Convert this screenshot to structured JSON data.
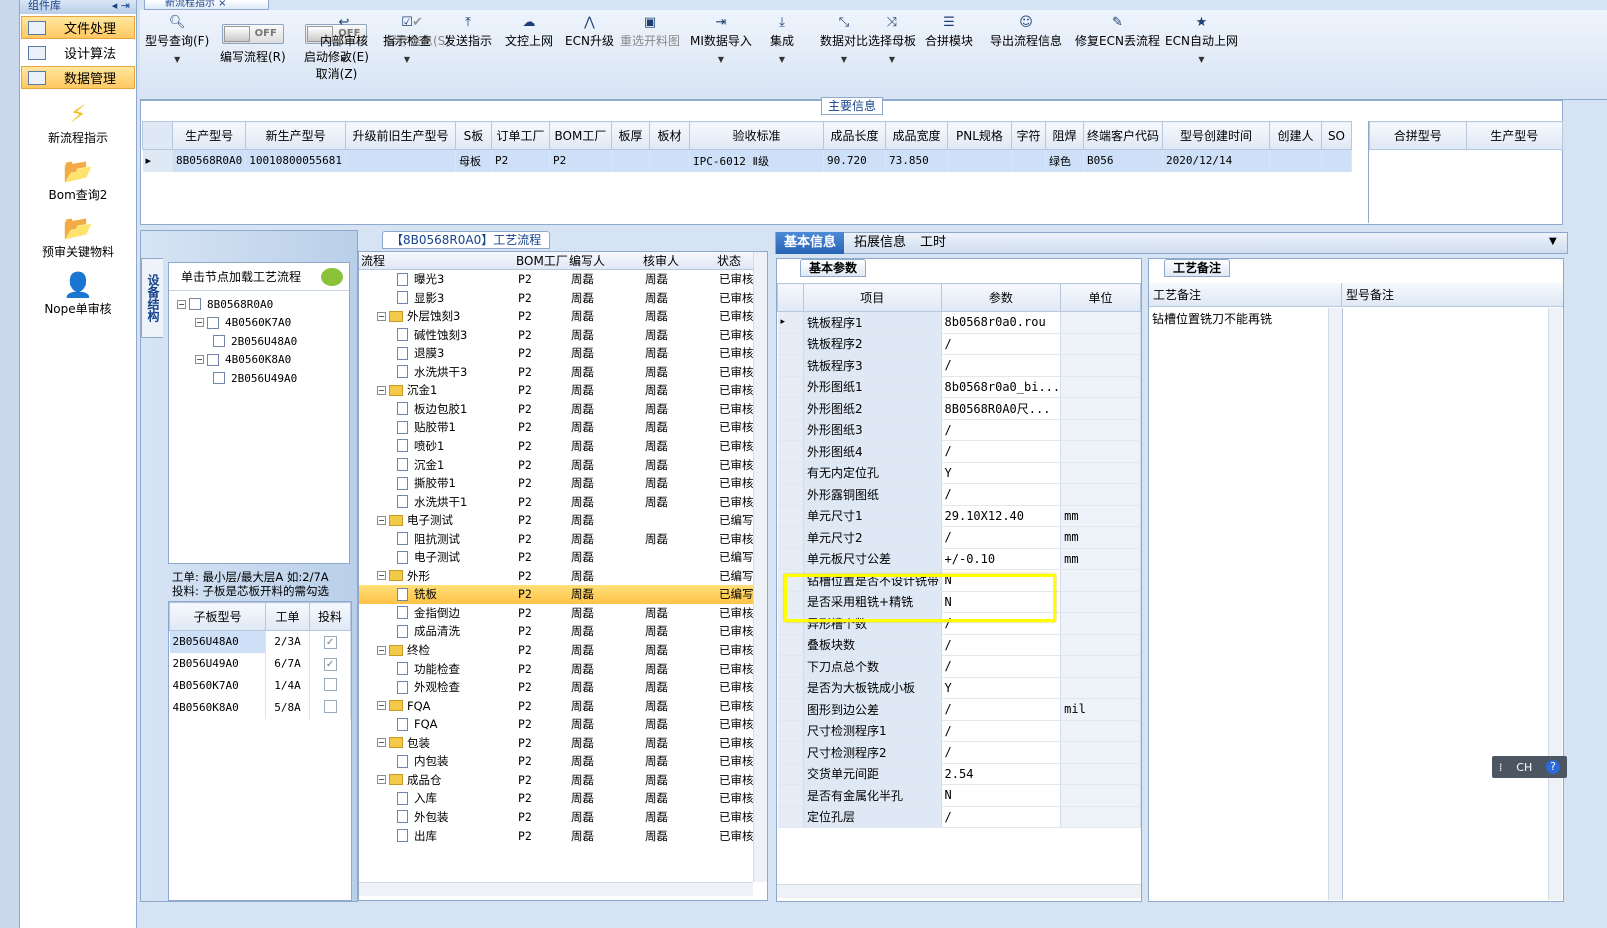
{
  "nav": {
    "title": "组件库",
    "items": [
      {
        "label": "文件处理",
        "selected": true
      },
      {
        "label": "设计算法",
        "selected": false
      },
      {
        "label": "数据管理",
        "selected": true
      }
    ],
    "big_icons": [
      {
        "label": "新流程指示",
        "icon": "lightning-icon"
      },
      {
        "label": "Bom查询2",
        "icon": "folder-icon"
      },
      {
        "label": "预审关键物料",
        "icon": "folder-icon"
      },
      {
        "label": "Nope单审核",
        "icon": "user-icon"
      }
    ]
  },
  "doc_tab": "新流程指示",
  "toolbar": {
    "query": "型号查询(F)",
    "write_flow": "编写流程(R)",
    "start_modify": "启动修改(E)",
    "cancel": "取消(Z)",
    "toggle_off": "OFF",
    "save": "保存信息(S)",
    "buttons": [
      {
        "label": "内部审核",
        "icon": "↩",
        "dropdown": true
      },
      {
        "label": "指示检查",
        "icon": "☑",
        "dropdown": true
      },
      {
        "label": "发送指示",
        "icon": "⤒",
        "dropdown": false
      },
      {
        "label": "文控上网",
        "icon": "☁",
        "dropdown": false
      },
      {
        "label": "ECN升级",
        "icon": "⋀",
        "dropdown": false
      },
      {
        "label": "重选开料图",
        "icon": "▣",
        "dropdown": false,
        "disabled": true
      },
      {
        "label": "MI数据导入",
        "icon": "⇥",
        "dropdown": true
      },
      {
        "label": "集成",
        "icon": "⤓",
        "dropdown": true
      },
      {
        "label": "数据对比",
        "icon": "⤡",
        "dropdown": true
      },
      {
        "label": "选择母板",
        "icon": "⤨",
        "dropdown": true
      },
      {
        "label": "合拼模块",
        "icon": "☰",
        "dropdown": false
      },
      {
        "label": "导出流程信息",
        "icon": "☺",
        "dropdown": false
      },
      {
        "label": "修复ECN丢流程",
        "icon": "✎",
        "dropdown": false
      },
      {
        "label": "ECN自动上网",
        "icon": "★",
        "dropdown": true
      }
    ]
  },
  "main_info": {
    "legend": "主要信息",
    "columns": [
      "生产型号",
      "新生产型号",
      "升级前旧生产型号",
      "S板",
      "订单工厂",
      "BOM工厂",
      "板厚",
      "板材",
      "验收标准",
      "成品长度",
      "成品宽度",
      "PNL规格",
      "字符",
      "阻焊",
      "终端客户代码",
      "型号创建时间",
      "创建人",
      "SO"
    ],
    "row": [
      "8B0568R0A0",
      "10010800055681",
      "",
      "母板",
      "P2",
      "P2",
      "",
      "",
      "IPC-6012 Ⅱ级",
      "90.720",
      "73.850",
      "",
      "",
      "绿色",
      "B056",
      "2020/12/14",
      "",
      ""
    ],
    "merge_columns": [
      "合拼型号",
      "生产型号"
    ]
  },
  "tree_panel": {
    "side_tab": "设备结构",
    "header": "单击节点加载工艺流程",
    "nodes": [
      {
        "label": "8B0568R0A0",
        "level": 0
      },
      {
        "label": "4B0560K7A0",
        "level": 1
      },
      {
        "label": "2B056U48A0",
        "level": 2
      },
      {
        "label": "4B0560K8A0",
        "level": 1
      },
      {
        "label": "2B056U49A0",
        "level": 2
      }
    ],
    "note1": "工单: 最小层/最大层A 如:2/7A",
    "note2": "投料: 子板是芯板开料的需勾选",
    "sub_columns": [
      "子板型号",
      "工单",
      "投料"
    ],
    "sub_rows": [
      {
        "model": "2B056U48A0",
        "order": "2/3A",
        "checked": true
      },
      {
        "model": "2B056U49A0",
        "order": "6/7A",
        "checked": true
      },
      {
        "model": "4B0560K7A0",
        "order": "1/4A",
        "checked": false
      },
      {
        "model": "4B0560K8A0",
        "order": "5/8A",
        "checked": false
      }
    ]
  },
  "flow_panel": {
    "title": "【8B0568R0A0】工艺流程",
    "columns": [
      "流程",
      "BOM工厂",
      "编写人",
      "核审人",
      "状态"
    ],
    "rows": [
      {
        "name": "曝光3",
        "type": "doc",
        "bom": "P2",
        "writer": "周磊",
        "checker": "周磊",
        "status": "已审核"
      },
      {
        "name": "显影3",
        "type": "doc",
        "bom": "P2",
        "writer": "周磊",
        "checker": "周磊",
        "status": "已审核"
      },
      {
        "name": "外层蚀刻3",
        "type": "folder",
        "bom": "P2",
        "writer": "周磊",
        "checker": "周磊",
        "status": "已审核"
      },
      {
        "name": "碱性蚀刻3",
        "type": "doc",
        "bom": "P2",
        "writer": "周磊",
        "checker": "周磊",
        "status": "已审核"
      },
      {
        "name": "退膜3",
        "type": "doc",
        "bom": "P2",
        "writer": "周磊",
        "checker": "周磊",
        "status": "已审核"
      },
      {
        "name": "水洗烘干3",
        "type": "doc",
        "bom": "P2",
        "writer": "周磊",
        "checker": "周磊",
        "status": "已审核"
      },
      {
        "name": "沉金1",
        "type": "folder",
        "bom": "P2",
        "writer": "周磊",
        "checker": "周磊",
        "status": "已审核"
      },
      {
        "name": "板边包胶1",
        "type": "doc",
        "bom": "P2",
        "writer": "周磊",
        "checker": "周磊",
        "status": "已审核"
      },
      {
        "name": "贴胶带1",
        "type": "doc",
        "bom": "P2",
        "writer": "周磊",
        "checker": "周磊",
        "status": "已审核"
      },
      {
        "name": "喷砂1",
        "type": "doc",
        "bom": "P2",
        "writer": "周磊",
        "checker": "周磊",
        "status": "已审核"
      },
      {
        "name": "沉金1",
        "type": "doc",
        "bom": "P2",
        "writer": "周磊",
        "checker": "周磊",
        "status": "已审核"
      },
      {
        "name": "撕胶带1",
        "type": "doc",
        "bom": "P2",
        "writer": "周磊",
        "checker": "周磊",
        "status": "已审核"
      },
      {
        "name": "水洗烘干1",
        "type": "doc",
        "bom": "P2",
        "writer": "周磊",
        "checker": "周磊",
        "status": "已审核"
      },
      {
        "name": "电子测试",
        "type": "folder",
        "bom": "P2",
        "writer": "周磊",
        "checker": "",
        "status": "已编写"
      },
      {
        "name": "阻抗测试",
        "type": "doc",
        "bom": "P2",
        "writer": "周磊",
        "checker": "周磊",
        "status": "已审核"
      },
      {
        "name": "电子测试",
        "type": "doc",
        "bom": "P2",
        "writer": "周磊",
        "checker": "",
        "status": "已编写"
      },
      {
        "name": "外形",
        "type": "folder",
        "bom": "P2",
        "writer": "周磊",
        "checker": "",
        "status": "已编写"
      },
      {
        "name": "铣板",
        "type": "doc",
        "bom": "P2",
        "writer": "周磊",
        "checker": "",
        "status": "已编写",
        "selected": true
      },
      {
        "name": "金指倒边",
        "type": "doc",
        "bom": "P2",
        "writer": "周磊",
        "checker": "周磊",
        "status": "已审核"
      },
      {
        "name": "成品清洗",
        "type": "doc",
        "bom": "P2",
        "writer": "周磊",
        "checker": "周磊",
        "status": "已审核"
      },
      {
        "name": "终检",
        "type": "folder",
        "bom": "P2",
        "writer": "周磊",
        "checker": "周磊",
        "status": "已审核"
      },
      {
        "name": "功能检查",
        "type": "doc",
        "bom": "P2",
        "writer": "周磊",
        "checker": "周磊",
        "status": "已审核"
      },
      {
        "name": "外观检查",
        "type": "doc",
        "bom": "P2",
        "writer": "周磊",
        "checker": "周磊",
        "status": "已审核"
      },
      {
        "name": "FQA",
        "type": "folder",
        "bom": "P2",
        "writer": "周磊",
        "checker": "周磊",
        "status": "已审核"
      },
      {
        "name": "FQA",
        "type": "doc",
        "bom": "P2",
        "writer": "周磊",
        "checker": "周磊",
        "status": "已审核"
      },
      {
        "name": "包装",
        "type": "folder",
        "bom": "P2",
        "writer": "周磊",
        "checker": "周磊",
        "status": "已审核"
      },
      {
        "name": "内包装",
        "type": "doc",
        "bom": "P2",
        "writer": "周磊",
        "checker": "周磊",
        "status": "已审核"
      },
      {
        "name": "成品仓",
        "type": "folder",
        "bom": "P2",
        "writer": "周磊",
        "checker": "周磊",
        "status": "已审核"
      },
      {
        "name": "入库",
        "type": "doc",
        "bom": "P2",
        "writer": "周磊",
        "checker": "周磊",
        "status": "已审核"
      },
      {
        "name": "外包装",
        "type": "doc",
        "bom": "P2",
        "writer": "周磊",
        "checker": "周磊",
        "status": "已审核"
      },
      {
        "name": "出库",
        "type": "doc",
        "bom": "P2",
        "writer": "周磊",
        "checker": "周磊",
        "status": "已审核"
      }
    ]
  },
  "info_tabs": [
    "基本信息",
    "拓展信息",
    "工时"
  ],
  "params": {
    "tab": "基本参数",
    "columns": [
      "项目",
      "参数",
      "单位"
    ],
    "rows": [
      {
        "item": "铣板程序1",
        "value": "8b0568r0a0.rou",
        "unit": ""
      },
      {
        "item": "铣板程序2",
        "value": "/",
        "unit": ""
      },
      {
        "item": "铣板程序3",
        "value": "/",
        "unit": ""
      },
      {
        "item": "外形图纸1",
        "value": "8b0568r0a0_bi...",
        "unit": ""
      },
      {
        "item": "外形图纸2",
        "value": "8B0568R0A0尺...",
        "unit": ""
      },
      {
        "item": "外形图纸3",
        "value": "/",
        "unit": ""
      },
      {
        "item": "外形图纸4",
        "value": "/",
        "unit": ""
      },
      {
        "item": "有无内定位孔",
        "value": "Y",
        "unit": ""
      },
      {
        "item": "外形露铜图纸",
        "value": "/",
        "unit": ""
      },
      {
        "item": "单元尺寸1",
        "value": "29.10X12.40",
        "unit": "mm"
      },
      {
        "item": "单元尺寸2",
        "value": "/",
        "unit": "mm"
      },
      {
        "item": "单元板尺寸公差",
        "value": "+/-0.10",
        "unit": "mm"
      },
      {
        "item": "钻槽位置是否不设计铣带",
        "value": "N",
        "unit": ""
      },
      {
        "item": "是否采用粗铣+精铣",
        "value": "N",
        "unit": ""
      },
      {
        "item": "异形槽个数",
        "value": "/",
        "unit": ""
      },
      {
        "item": "叠板块数",
        "value": "/",
        "unit": ""
      },
      {
        "item": "下刀点总个数",
        "value": "/",
        "unit": ""
      },
      {
        "item": "是否为大板铣成小板",
        "value": "Y",
        "unit": ""
      },
      {
        "item": "图形到边公差",
        "value": "/",
        "unit": "mil"
      },
      {
        "item": "尺寸检测程序1",
        "value": "/",
        "unit": ""
      },
      {
        "item": "尺寸检测程序2",
        "value": "/",
        "unit": ""
      },
      {
        "item": "交货单元间距",
        "value": "2.54",
        "unit": ""
      },
      {
        "item": "是否有金属化半孔",
        "value": "N",
        "unit": ""
      },
      {
        "item": "定位孔层",
        "value": "/",
        "unit": ""
      }
    ]
  },
  "remarks": {
    "tab": "工艺备注",
    "col1": "工艺备注",
    "col2": "型号备注",
    "text": "钻槽位置铣刀不能再铣"
  },
  "ime": {
    "label": "CH"
  },
  "colors": {
    "highlight_box": "#ffff00",
    "selected_nav": "#ffd36b",
    "accent": "#15428b"
  }
}
